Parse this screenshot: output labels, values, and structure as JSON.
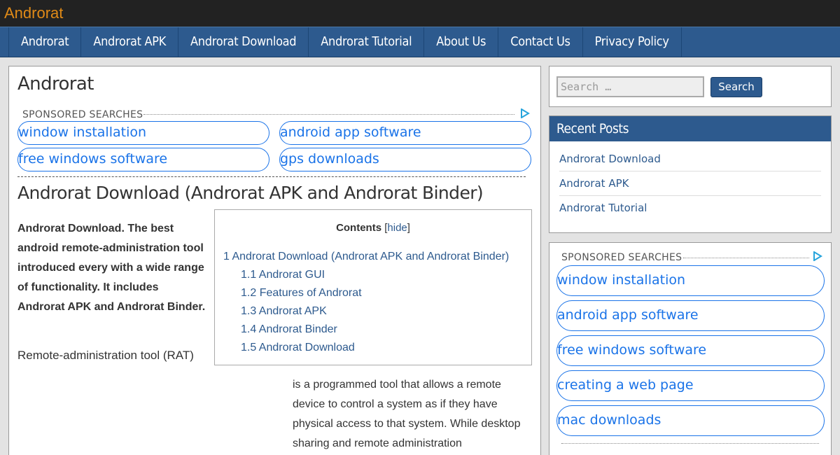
{
  "site": {
    "title": "Androrat"
  },
  "nav": [
    {
      "label": "Androrat"
    },
    {
      "label": "Androrat APK"
    },
    {
      "label": "Androrat Download"
    },
    {
      "label": "Androrat Tutorial"
    },
    {
      "label": "About Us"
    },
    {
      "label": "Contact Us"
    },
    {
      "label": "Privacy Policy"
    }
  ],
  "main": {
    "page_title": "Androrat",
    "sponsored_label": "SPONSORED SEARCHES",
    "ads": [
      "window installation",
      "android app software",
      "free windows software",
      "gps downloads"
    ],
    "post_title": "Androrat Download (Androrat APK and Androrat Binder)",
    "intro": "Androrat Download. The best android remote-administration tool introduced every with a wide range of functionality. It includes Androrat APK and Androrat Binder.",
    "rat_line": "Remote-administration tool (RAT)",
    "body": "is a programmed tool that allows a remote device to control a system as if they have physical access to that system. While desktop sharing and remote administration",
    "toc": {
      "title": "Contents",
      "hide": "hide",
      "items": [
        "1 Androrat Download (Androrat APK and Androrat Binder)",
        "1.1 Androrat GUI",
        "1.2 Features of Androrat",
        "1.3 Androrat APK",
        "1.4 Androrat Binder",
        "1.5 Androrat Download"
      ]
    }
  },
  "sidebar": {
    "search": {
      "placeholder": "Search …",
      "button": "Search"
    },
    "recent": {
      "title": "Recent Posts",
      "items": [
        "Androrat Download",
        "Androrat APK",
        "Androrat Tutorial"
      ]
    },
    "sponsored_label": "SPONSORED SEARCHES",
    "ads": [
      "window installation",
      "android app software",
      "free windows software",
      "creating a web page",
      "mac downloads"
    ]
  },
  "colors": {
    "brand_orange": "#e08a17",
    "nav_blue": "#2d5a8e",
    "ad_blue": "#1a73e8"
  }
}
